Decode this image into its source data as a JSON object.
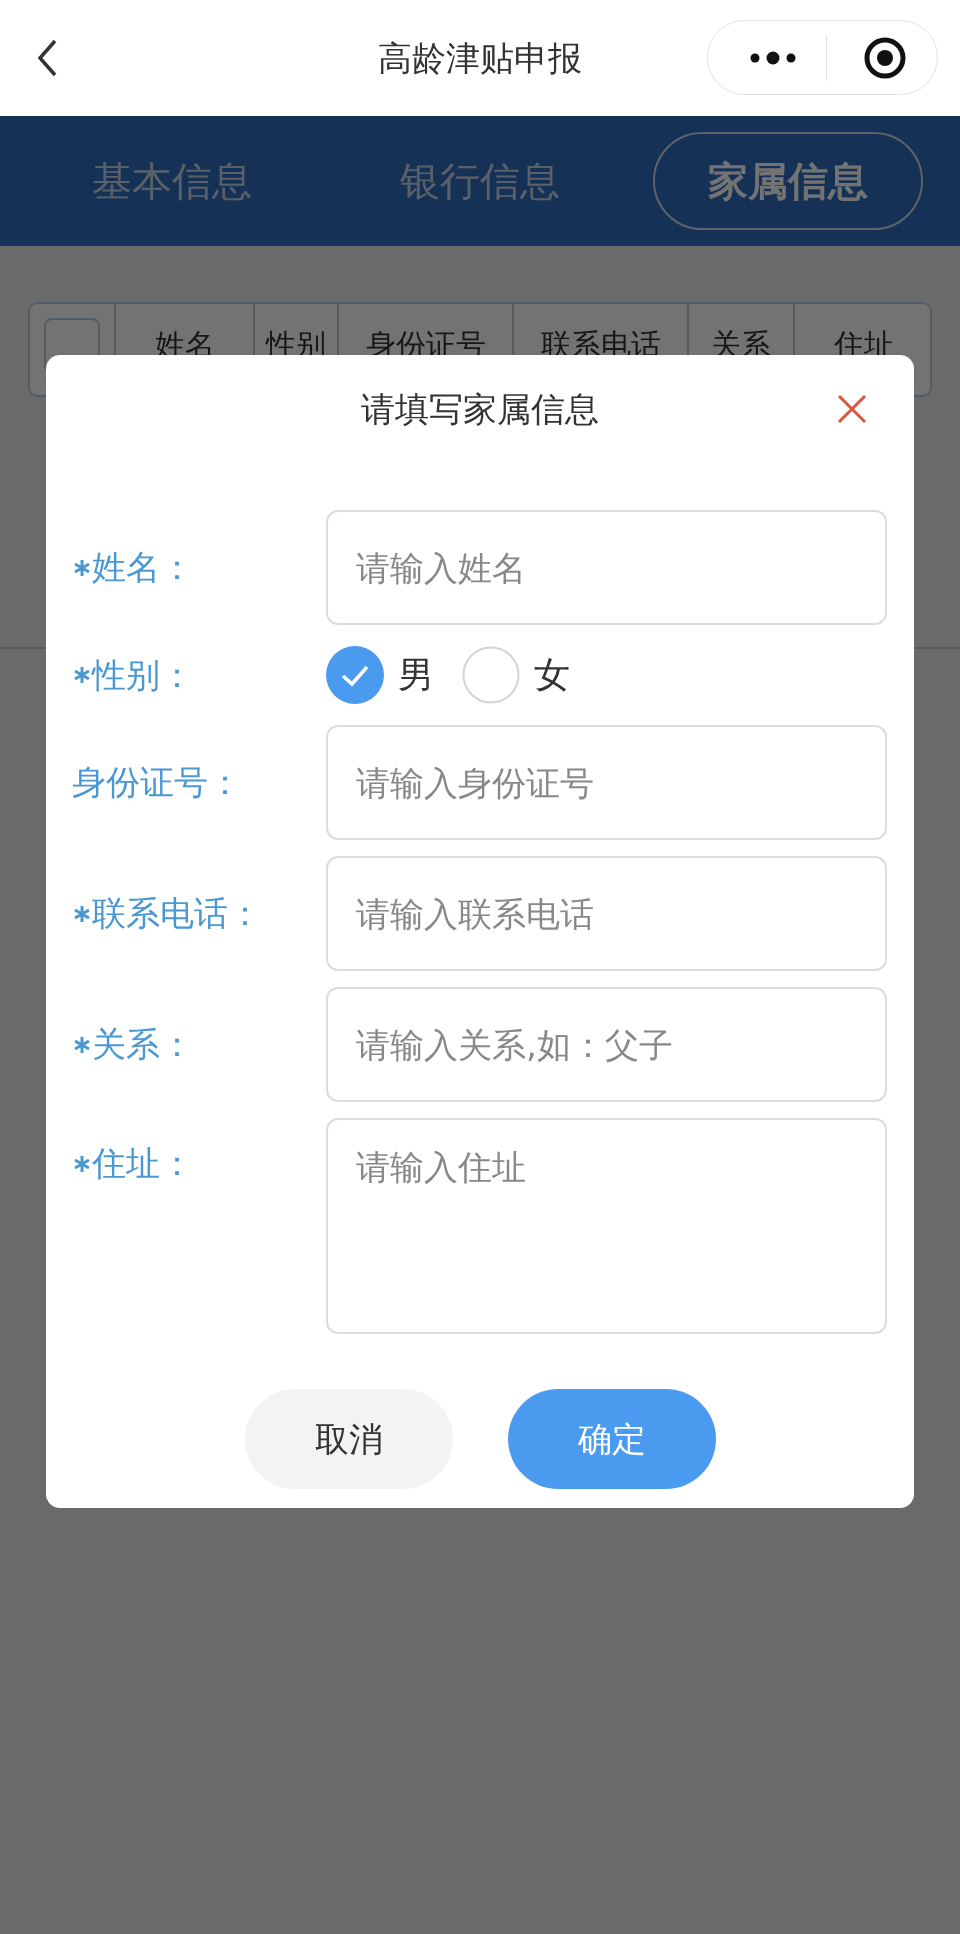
{
  "nav": {
    "title": "高龄津贴申报"
  },
  "tabs": [
    {
      "label": "基本信息",
      "selected": false
    },
    {
      "label": "银行信息",
      "selected": false
    },
    {
      "label": "家属信息",
      "selected": true
    }
  ],
  "table": {
    "select_all": {
      "checked": false
    },
    "columns": [
      "姓名",
      "性别",
      "身份证号",
      "联系电话",
      "关系",
      "住址"
    ]
  },
  "dialog": {
    "title": "请填写家属信息",
    "fields": [
      {
        "kind": "input",
        "label": "姓名：",
        "required": true,
        "placeholder": "请输入姓名"
      },
      {
        "kind": "radio",
        "label": "性别：",
        "required": true,
        "options": [
          {
            "label": "男",
            "selected": true
          },
          {
            "label": "女",
            "selected": false
          }
        ]
      },
      {
        "kind": "input",
        "label": "身份证号：",
        "required": false,
        "placeholder": "请输入身份证号"
      },
      {
        "kind": "input",
        "label": "联系电话：",
        "required": true,
        "placeholder": "请输入联系电话"
      },
      {
        "kind": "input",
        "label": "关系：",
        "required": true,
        "placeholder": "请输入关系,如：父子"
      },
      {
        "kind": "textarea",
        "label": "住址：",
        "required": true,
        "placeholder": "请输入住址"
      }
    ],
    "buttons": [
      {
        "kind": "cancel",
        "label": "取消"
      },
      {
        "kind": "primary",
        "label": "确定"
      }
    ]
  }
}
